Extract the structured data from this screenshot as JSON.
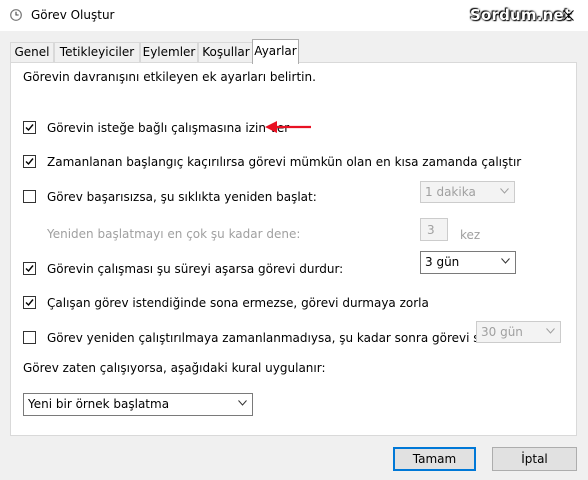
{
  "window": {
    "title": "Görev Oluştur",
    "watermark": "Sordum.net"
  },
  "tabs": [
    {
      "label": "Genel"
    },
    {
      "label": "Tetikleyiciler"
    },
    {
      "label": "Eylemler"
    },
    {
      "label": "Koşullar"
    },
    {
      "label": "Ayarlar",
      "active": true
    }
  ],
  "settings": {
    "description": "Görevin davranışını etkileyen ek ayarları belirtin.",
    "allow_on_demand": {
      "label": "Görevin isteğe bağlı çalışmasına izin ver",
      "checked": true
    },
    "run_after_missed": {
      "label": "Zamanlanan başlangıç kaçırılırsa görevi mümkün olan en kısa zamanda çalıştır",
      "checked": true
    },
    "restart_on_fail": {
      "label": "Görev başarısızsa, şu sıklıkta yeniden başlat:",
      "checked": false,
      "interval": "1 dakika"
    },
    "restart_attempts": {
      "label": "Yeniden başlatmayı en çok şu kadar dene:",
      "value": "3",
      "unit": "kez"
    },
    "stop_if_longer": {
      "label": "Görevin çalışması şu süreyi aşarsa görevi durdur:",
      "checked": true,
      "duration": "3 gün"
    },
    "force_stop": {
      "label": "Çalışan görev istendiğinde sona ermezse, görevi durmaya zorla",
      "checked": true
    },
    "delete_if_not_scheduled": {
      "label": "Görev yeniden çalıştırılmaya zamanlanmadıysa, şu kadar sonra görevi sil:",
      "checked": false,
      "duration": "30 gün"
    },
    "already_running_label": "Görev zaten çalışıyorsa, aşağıdaki kural uygulanır:",
    "already_running_rule": "Yeni bir örnek başlatma"
  },
  "buttons": {
    "ok": "Tamam",
    "cancel": "İptal"
  },
  "colors": {
    "accent": "#0078d7",
    "arrow": "#e81123"
  }
}
